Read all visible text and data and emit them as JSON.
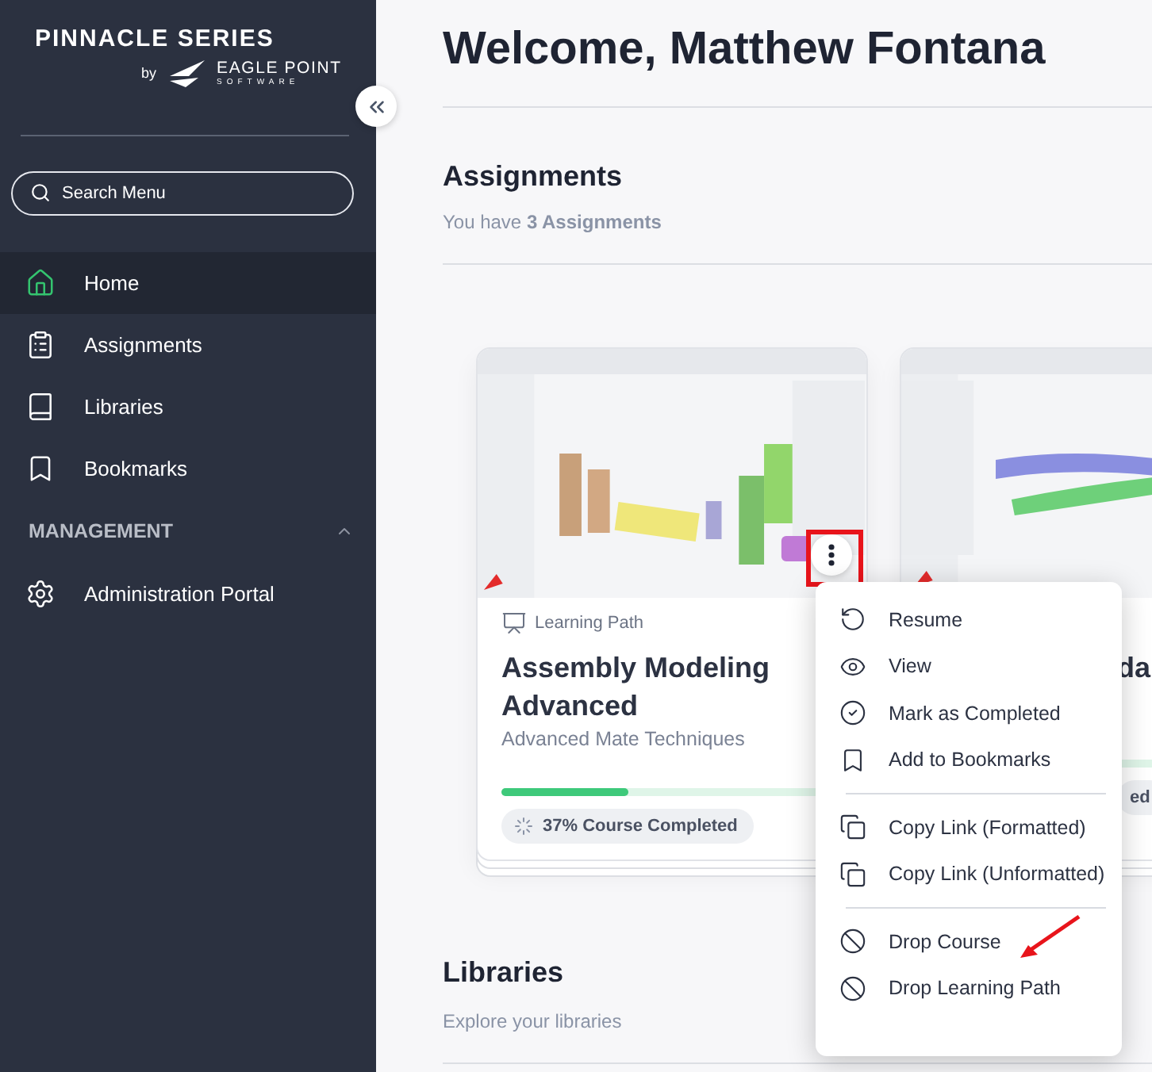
{
  "sidebar": {
    "brand": {
      "title": "PINNACLE SERIES",
      "by": "by",
      "company": "EAGLE POINT",
      "company_sub": "SOFTWARE"
    },
    "search": {
      "placeholder": "Search Menu"
    },
    "items": [
      {
        "label": "Home",
        "selected": true
      },
      {
        "label": "Assignments",
        "selected": false
      },
      {
        "label": "Libraries",
        "selected": false
      },
      {
        "label": "Bookmarks",
        "selected": false
      }
    ],
    "section": {
      "title": "MANAGEMENT",
      "expanded": true,
      "items": [
        {
          "label": "Administration Portal",
          "selected": false
        }
      ]
    }
  },
  "main": {
    "title": "Welcome, Matthew Fontana",
    "assignments": {
      "title": "Assignments",
      "summary": "You have **3 Assignments**",
      "cards": [
        {
          "type": "Learning Path",
          "title": "Assembly Modeling Advanced",
          "subtitle": "Advanced Mate Techniques",
          "level": 0.37,
          "progress": "37% Course Completed",
          "menu_open": true
        },
        {
          "title": "da",
          "progress": "ed"
        }
      ]
    },
    "libraries": {
      "title": "Libraries",
      "subtitle": "Explore your libraries"
    }
  },
  "context_menu": {
    "groups": [
      [
        {
          "label": "Resume"
        },
        {
          "label": "View"
        },
        {
          "label": "Mark as Completed"
        },
        {
          "label": "Add to Bookmarks"
        }
      ],
      [
        {
          "label": "Copy Link (Formatted)"
        },
        {
          "label": "Copy Link (Unformatted)"
        }
      ],
      [
        {
          "label": "Drop Course"
        },
        {
          "label": "Drop Learning Path"
        }
      ]
    ]
  }
}
